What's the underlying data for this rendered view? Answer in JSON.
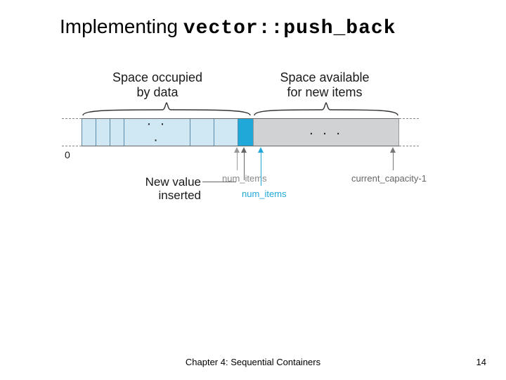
{
  "title": {
    "plain": "Implementing ",
    "mono": "vector::push_back"
  },
  "topLabels": {
    "left_line1": "Space occupied",
    "left_line2": "by data",
    "right_line1": "Space available",
    "right_line2": "for new items"
  },
  "array": {
    "dots": ". . .",
    "zero_index": "0"
  },
  "bottomLabels": {
    "new_value_line1": "New value",
    "new_value_line2": "inserted",
    "num_items_old": "num_items",
    "num_items_new": "num_items",
    "capacity": "current_capacity-1"
  },
  "footer": {
    "chapter": "Chapter 4: Sequential Containers",
    "page": "14"
  }
}
